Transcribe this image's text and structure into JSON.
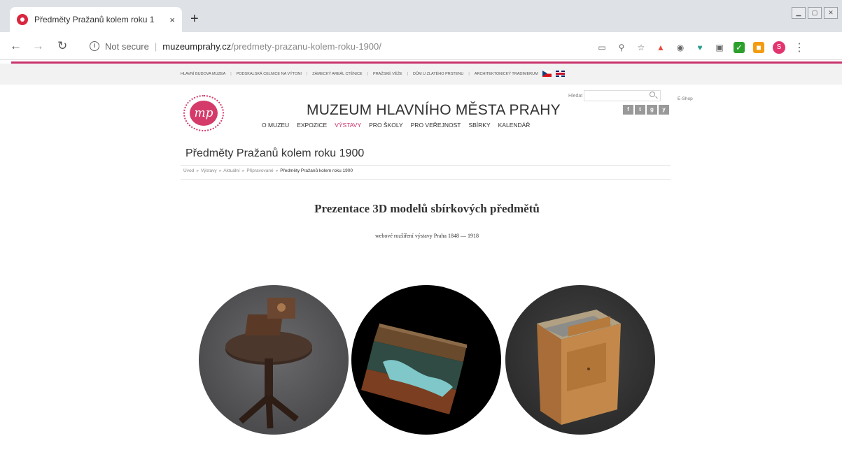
{
  "browser": {
    "tab_title": "Předměty Pražanů kolem roku 1",
    "tab_close": "×",
    "new_tab": "+",
    "not_secure": "Not secure",
    "url_host": "muzeumprahy.cz",
    "url_path": "/predmety-prazanu-kolem-roku-1900/",
    "profile_initial": "S"
  },
  "top_links": [
    "HLAVNÍ BUDOVA MUZEA",
    "PODSKALSKÁ CELNICE NA VÝTONI",
    "ZÁMECKÝ AREÁL CTĚNICE",
    "PRAŽSKÉ VĚŽE",
    "DŮM U ZLATÉHO PRSTENU",
    "ARCHITEKTONICKÝ TRADIMERUM"
  ],
  "header": {
    "logo_text": "mp",
    "site_title": "MUZEUM HLAVNÍHO MĚSTA PRAHY",
    "search_label": "Hledat",
    "eshop": "E-Shop",
    "social": [
      "f",
      "t",
      "g",
      "y"
    ]
  },
  "nav": [
    {
      "label": "O MUZEU",
      "active": false
    },
    {
      "label": "EXPOZICE",
      "active": false
    },
    {
      "label": "VÝSTAVY",
      "active": true
    },
    {
      "label": "PRO ŠKOLY",
      "active": false
    },
    {
      "label": "PRO VEŘEJNOST",
      "active": false
    },
    {
      "label": "SBÍRKY",
      "active": false
    },
    {
      "label": "KALENDÁŘ",
      "active": false
    }
  ],
  "page": {
    "title": "Předměty Pražanů kolem roku 1900",
    "breadcrumb": [
      "Úvod",
      "Výstavy",
      "Aktuální",
      "Připravované",
      "Předměty Pražanů kolem roku 1900"
    ],
    "heading": "Prezentace 3D modelů sbírkových předmětů",
    "subheading": "webové rozšíření výstavy Praha 1848 — 1918"
  },
  "colors": {
    "accent": "#c8336b"
  }
}
